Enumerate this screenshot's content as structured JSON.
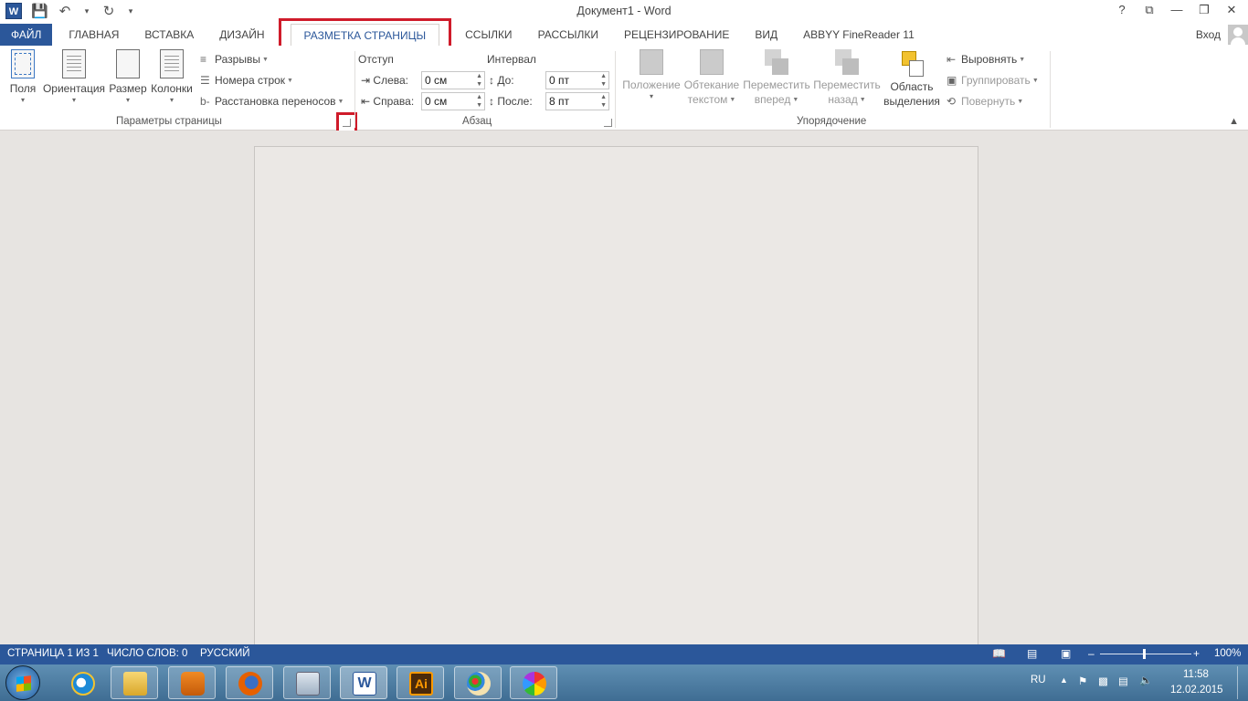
{
  "window": {
    "title": "Документ1 - Word",
    "controls": [
      "?",
      "⧉",
      "—",
      "❐",
      "✕"
    ]
  },
  "qat": {
    "icons": [
      "word-icon",
      "save-icon",
      "undo-icon",
      "redo-icon",
      "customize-icon"
    ],
    "word_letter": "W"
  },
  "tabs": [
    {
      "label": "ФАЙЛ"
    },
    {
      "label": "ГЛАВНАЯ"
    },
    {
      "label": "ВСТАВКА"
    },
    {
      "label": "ДИЗАЙН"
    },
    {
      "label": "РАЗМЕТКА СТРАНИЦЫ"
    },
    {
      "label": "ССЫЛКИ"
    },
    {
      "label": "РАССЫЛКИ"
    },
    {
      "label": "РЕЦЕНЗИРОВАНИЕ"
    },
    {
      "label": "ВИД"
    },
    {
      "label": "ABBYY FineReader 11"
    }
  ],
  "account": {
    "login": "Вход"
  },
  "ribbon": {
    "page_setup": {
      "label": "Параметры страницы",
      "fields": "Поля",
      "orientation": "Ориентация",
      "size": "Размер",
      "columns": "Колонки",
      "breaks": "Разрывы",
      "line_numbers": "Номера строк",
      "hyphenation": "Расстановка переносов"
    },
    "paragraph": {
      "label": "Абзац",
      "indent_title": "Отступ",
      "left_label": "Слева:",
      "left_value": "0 см",
      "right_label": "Справа:",
      "right_value": "0 см",
      "spacing_title": "Интервал",
      "before_label": "До:",
      "before_value": "0 пт",
      "after_label": "После:",
      "after_value": "8 пт"
    },
    "arrange": {
      "label": "Упорядочение",
      "position": "Положение",
      "wrap_text_1": "Обтекание",
      "wrap_text_2": "текстом",
      "bring_forward_1": "Переместить",
      "bring_forward_2": "вперед",
      "send_backward_1": "Переместить",
      "send_backward_2": "назад",
      "selection_pane_1": "Область",
      "selection_pane_2": "выделения",
      "align": "Выровнять",
      "group": "Группировать",
      "rotate": "Повернуть"
    }
  },
  "status": {
    "page": "СТРАНИЦА 1 ИЗ 1",
    "words": "ЧИСЛО СЛОВ: 0",
    "language": "РУССКИЙ",
    "zoom": "100%",
    "zoom_level": 1.0
  },
  "taskbar": {
    "lang": "RU",
    "time": "11:58",
    "date": "12.02.2015",
    "apps": [
      "internet-explorer",
      "explorer",
      "media-player",
      "firefox",
      "calculator",
      "word",
      "illustrator",
      "paint",
      "picasa"
    ],
    "ai_label": "Ai"
  },
  "colors": {
    "accent": "#2b579a",
    "highlight": "#cf1b2a",
    "ai_bg": "#4b2a0a",
    "ai_fg": "#ff9a00"
  }
}
